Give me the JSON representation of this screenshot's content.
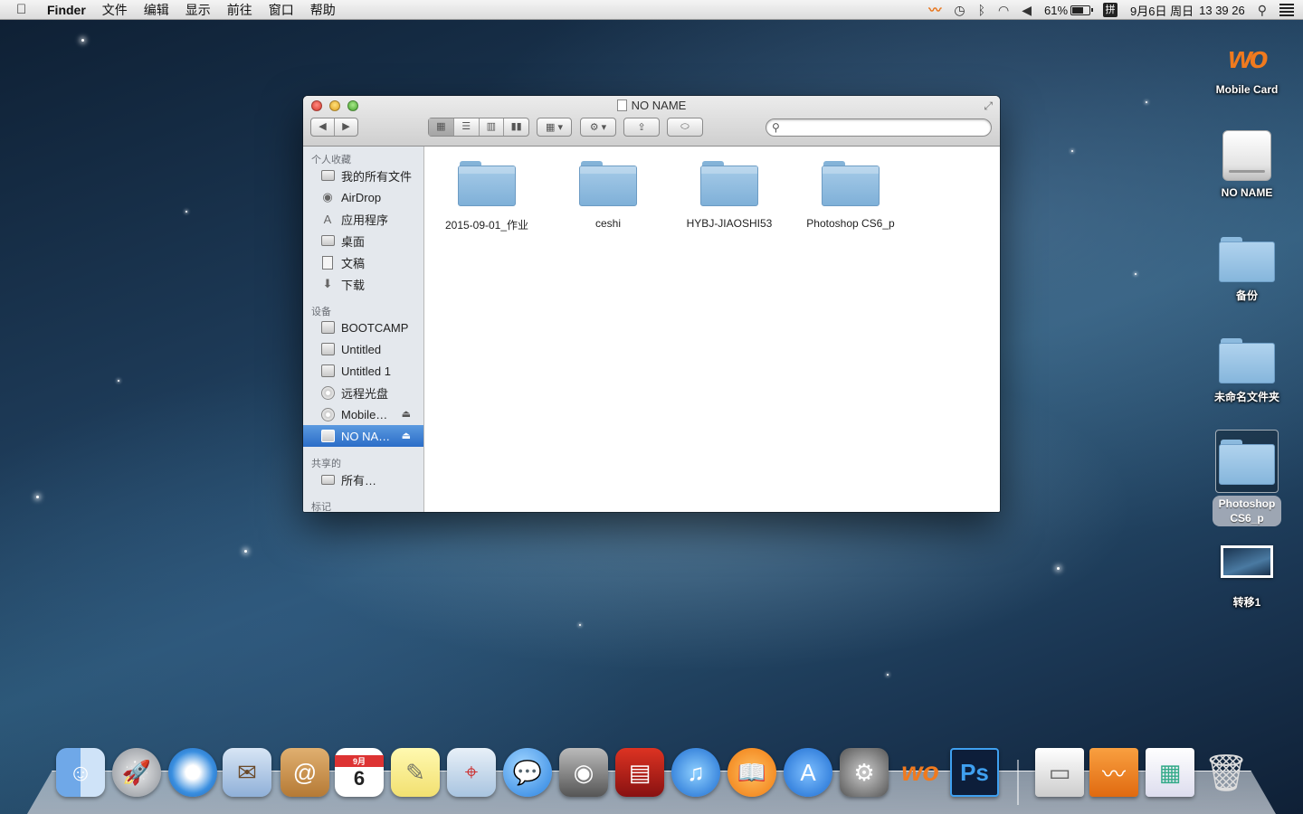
{
  "menubar": {
    "app_name": "Finder",
    "menus": [
      "文件",
      "编辑",
      "显示",
      "前往",
      "窗口",
      "帮助"
    ],
    "battery": "61%",
    "input_method": "拼",
    "date": "9月6日 周日",
    "time": "13 39 26"
  },
  "window": {
    "title": "NO NAME",
    "sidebar": {
      "favorites_header": "个人收藏",
      "favorites": [
        "我的所有文件",
        "AirDrop",
        "应用程序",
        "桌面",
        "文稿",
        "下载"
      ],
      "devices_header": "设备",
      "devices": [
        "BOOTCAMP",
        "Untitled",
        "Untitled 1",
        "远程光盘",
        "Mobile…",
        "NO NA…"
      ],
      "shared_header": "共享的",
      "shared": [
        "所有…"
      ],
      "tags_header": "标记"
    },
    "search": {
      "placeholder": "",
      "value": ""
    },
    "files": [
      "2015-09-01_作业",
      "ceshi",
      "HYBJ-JIAOSHI53",
      "Photoshop CS6_p"
    ]
  },
  "desktop": {
    "items": [
      "Mobile Card",
      "NO NAME",
      "备份",
      "未命名文件夹",
      "Photoshop CS6_p",
      "转移1"
    ]
  },
  "dock": {
    "calendar_month": "9月",
    "calendar_day": "6",
    "ps_label": "Ps"
  },
  "colors": {
    "accent_selection": "#3478d4",
    "folder_blue": "#8fbbe0",
    "unicom_orange": "#f07a1e"
  }
}
